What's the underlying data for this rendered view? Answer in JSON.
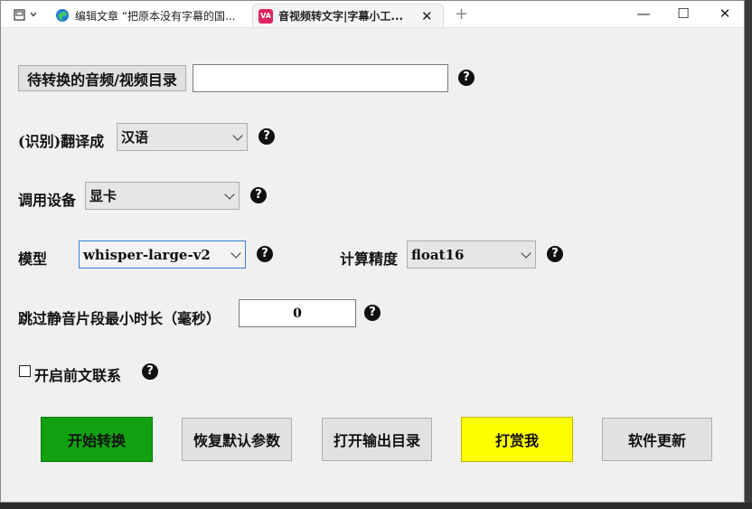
{
  "browser": {
    "tab1_title": "编辑文章 “把原本没有字幕的国...",
    "tab2_title": "音视频转文字|字幕小工...",
    "tab2_icon_text": "VA",
    "window_controls": {
      "minimize": "—",
      "maximize": "☐",
      "close": "✕"
    },
    "new_tab": "+"
  },
  "form": {
    "source_dir_button": "待转换的音频/视频目录",
    "source_dir_value": "",
    "translate_label": "(识别)翻译成",
    "translate_value": "汉语",
    "device_label": "调用设备",
    "device_value": "显卡",
    "model_label": "模型",
    "model_value": "whisper-large-v2",
    "precision_label": "计算精度",
    "precision_value": "float16",
    "silence_label": "跳过静音片段最小时长（毫秒）",
    "silence_value": "0",
    "context_label": "开启前文联系",
    "help_glyph": "?"
  },
  "actions": {
    "start": "开始转换",
    "reset": "恢复默认参数",
    "open_output": "打开输出目录",
    "donate": "打赏我",
    "update": "软件更新"
  },
  "colors": {
    "start_bg": "#10a010",
    "donate_bg": "#ffff00"
  }
}
